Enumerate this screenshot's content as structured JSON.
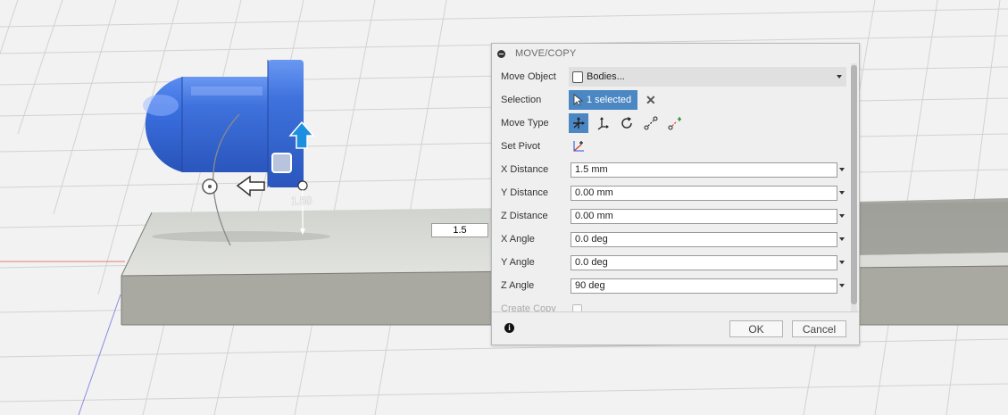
{
  "viewport": {
    "dimension_label": "1.50",
    "floating_input_value": "1.5"
  },
  "dialog": {
    "title": "MOVE/COPY",
    "rows": {
      "move_object": {
        "label": "Move Object",
        "value": "Bodies..."
      },
      "selection": {
        "label": "Selection",
        "button": "1 selected"
      },
      "move_type": {
        "label": "Move Type",
        "active": "free-move-icon"
      },
      "set_pivot": {
        "label": "Set Pivot"
      },
      "x_distance": {
        "label": "X Distance",
        "value": "1.5 mm"
      },
      "y_distance": {
        "label": "Y Distance",
        "value": "0.00 mm"
      },
      "z_distance": {
        "label": "Z Distance",
        "value": "0.00 mm"
      },
      "x_angle": {
        "label": "X Angle",
        "value": "0.0 deg"
      },
      "y_angle": {
        "label": "Y Angle",
        "value": "0.0 deg"
      },
      "z_angle": {
        "label": "Z Angle",
        "value": "90 deg"
      },
      "create_copy": {
        "label": "Create Copy"
      }
    },
    "buttons": {
      "ok": "OK",
      "cancel": "Cancel"
    }
  },
  "colors": {
    "accent": "#4b87c2",
    "body_blue": "#3d6fd8",
    "arrow_blue": "#1c8fe0"
  }
}
